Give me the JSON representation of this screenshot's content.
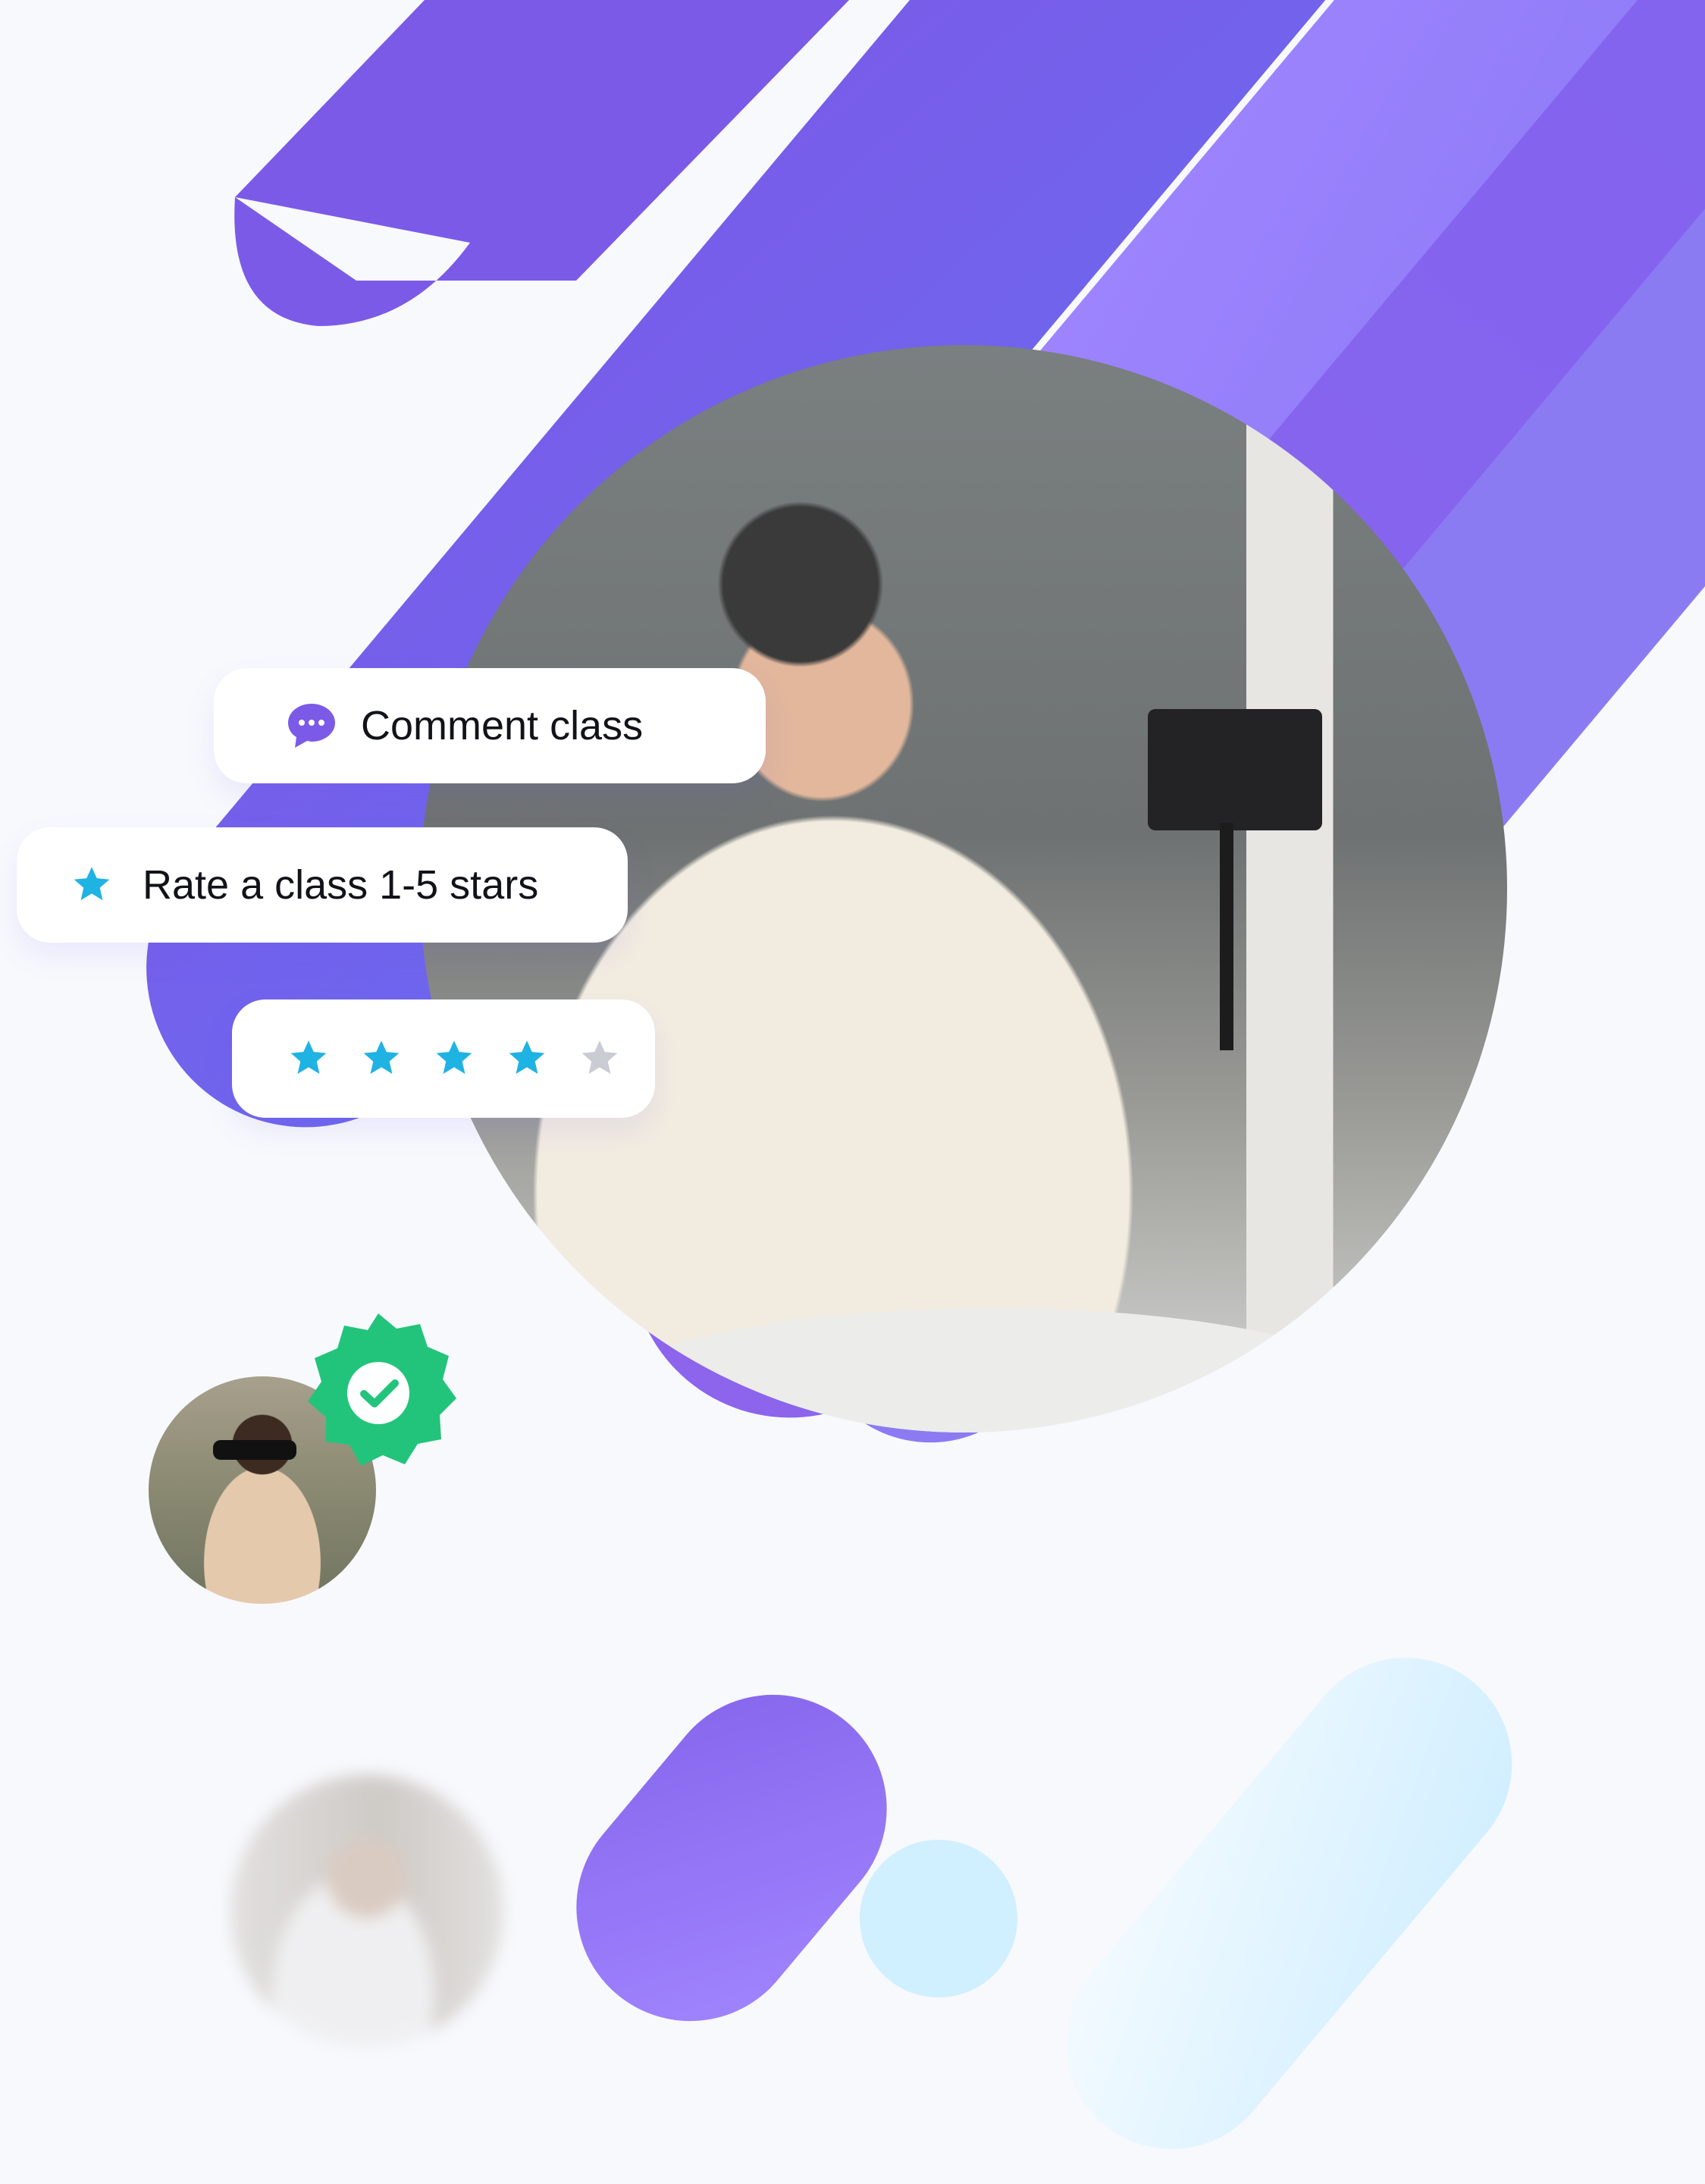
{
  "actions": {
    "comment_label": "Comment class",
    "rate_label": "Rate a class 1-5 stars"
  },
  "rating": {
    "value": 4,
    "max": 5
  },
  "icons": {
    "comment": "chat-bubble-icon",
    "rate": "star-icon",
    "verified": "verified-check-icon"
  },
  "colors": {
    "purple": "#7b5ae8",
    "purple_light": "#9b84ff",
    "star_active": "#1fb3e3",
    "star_inactive": "#c9ccd3",
    "badge_green": "#22c47b",
    "light_blue": "#cfefff"
  }
}
